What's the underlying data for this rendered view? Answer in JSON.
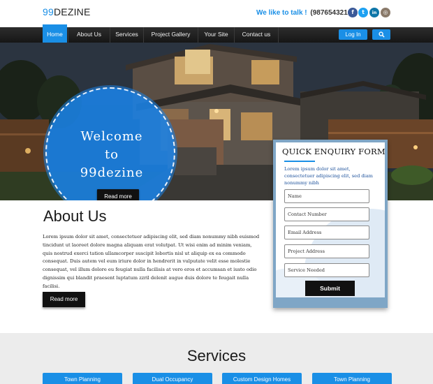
{
  "header": {
    "logo_num": "99",
    "logo_text": "DEZINE",
    "talk_label": "We like to talk !",
    "phone": "(9876543210)",
    "social": [
      {
        "name": "facebook",
        "glyph": "f",
        "color": "#3b5998"
      },
      {
        "name": "twitter",
        "glyph": "t",
        "color": "#1da1f2"
      },
      {
        "name": "linkedin",
        "glyph": "in",
        "color": "#0e76a8"
      },
      {
        "name": "instagram",
        "glyph": "◎",
        "color": "#8a7a6a"
      }
    ]
  },
  "nav": {
    "items": [
      "Home",
      "About Us",
      "Services",
      "Project Gallery",
      "Your Site",
      "Contact us"
    ],
    "active": "Home",
    "login": "Log In",
    "search_icon": "search-icon"
  },
  "hero": {
    "welcome_lines": [
      "Welcome",
      "to",
      "99dezine"
    ],
    "read_more": "Read more"
  },
  "about": {
    "title": "About Us",
    "text": "Lorem ipsum dolor sit amet, consectetuer adipiscing elit, sed diam nonummy nibh euismod tincidunt ut laoreet dolore magna aliquam erat volutpat. Ut wisi enim ad minim veniam, quis nostrud exerci tation ullamcorper suscipit lobortis nisl ut aliquip ex ea commodo consequat. Duis autem vel eum iriure dolor in hendrerit in vulputate velit esse molestie consequat, vel illum dolore eu feugiat nulla facilisis at vero eros et accumsan et iusto odio dignissim qui blandit praesent luptatum zzril delenit augue duis dolore te feugait nulla facilisi.",
    "read_more": "Read more"
  },
  "enquiry": {
    "title": "QUICK ENQUIRY FORM",
    "subtitle": "Lorem ipsum dolor sit amet, consectetuer adipiscing elit, sed diam nonummy nibh",
    "fields": [
      "Name",
      "Contact Number",
      "Email Address",
      "Project Address",
      "Service Needed"
    ],
    "submit": "Submit"
  },
  "services": {
    "title": "Services",
    "items": [
      "Town Planning",
      "Dual Occupancy",
      "Custom Design Homes",
      "Town Planning"
    ]
  },
  "colors": {
    "accent": "#1a8fe6",
    "nav_bg": "#1e1e1e",
    "button_dark": "#111111"
  }
}
